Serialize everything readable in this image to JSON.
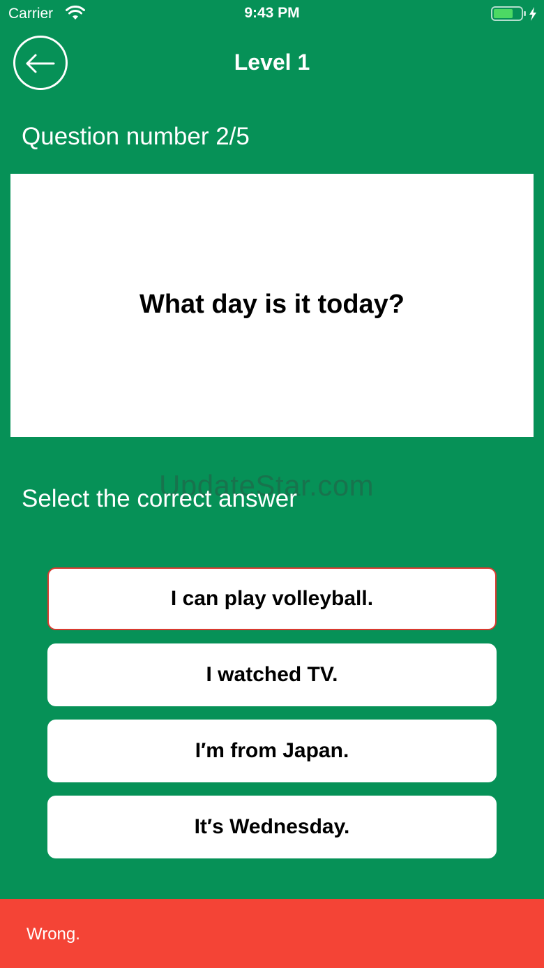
{
  "status_bar": {
    "carrier": "Carrier",
    "time": "9:43 PM",
    "wifi_icon": "wifi-icon",
    "battery_icon": "battery-charging-icon"
  },
  "nav": {
    "title": "Level 1",
    "back_icon": "arrow-left-icon"
  },
  "question": {
    "number_label": "Question number 2/5",
    "text": "What day is it today?"
  },
  "instruction": "Select the correct answer",
  "watermark": "UpdateStar.com",
  "answers": [
    {
      "label": "I can play volleyball.",
      "state": "wrong"
    },
    {
      "label": "I watched TV."
    },
    {
      "label": "I′m from Japan."
    },
    {
      "label": "It′s Wednesday."
    }
  ],
  "feedback": {
    "text": "Wrong."
  },
  "colors": {
    "background": "#069157",
    "card": "#ffffff",
    "wrong_border": "#d93a2f",
    "feedback_bar": "#f44436"
  }
}
